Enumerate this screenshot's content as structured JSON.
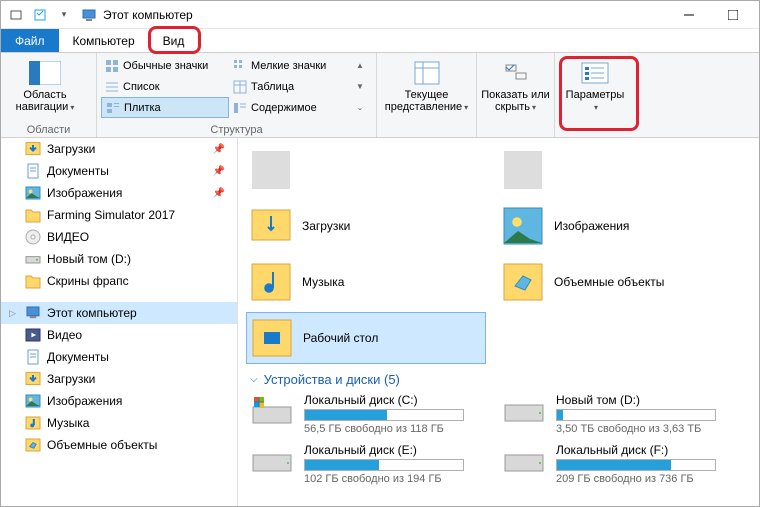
{
  "title": "Этот компьютер",
  "tabs": {
    "file": "Файл",
    "computer": "Компьютер",
    "view": "Вид"
  },
  "ribbon": {
    "nav_area": {
      "label": "Область навигации",
      "group": "Области"
    },
    "layout": {
      "regular": "Обычные значки",
      "small": "Мелкие значки",
      "list": "Список",
      "table": "Таблица",
      "tiles": "Плитка",
      "content": "Содержимое",
      "group": "Структура"
    },
    "view": {
      "current": "Текущее представление"
    },
    "show": {
      "label": "Показать или скрыть"
    },
    "params": {
      "label": "Параметры"
    }
  },
  "sidebar": [
    {
      "label": "Загрузки",
      "icon": "downloads",
      "pin": true
    },
    {
      "label": "Документы",
      "icon": "documents",
      "pin": true
    },
    {
      "label": "Изображения",
      "icon": "pictures",
      "pin": true
    },
    {
      "label": "Farming Simulator 2017",
      "icon": "folder"
    },
    {
      "label": "ВИДЕО",
      "icon": "disc"
    },
    {
      "label": "Новый том (D:)",
      "icon": "drive"
    },
    {
      "label": "Скрины фрапс",
      "icon": "folder"
    },
    {
      "label": "Этот компьютер",
      "icon": "pc",
      "selected": true,
      "chev": true
    },
    {
      "label": "Видео",
      "icon": "video"
    },
    {
      "label": "Документы",
      "icon": "documents"
    },
    {
      "label": "Загрузки",
      "icon": "downloads"
    },
    {
      "label": "Изображения",
      "icon": "pictures"
    },
    {
      "label": "Музыка",
      "icon": "music"
    },
    {
      "label": "Объемные объекты",
      "icon": "3d"
    }
  ],
  "folder_tiles": [
    {
      "label": "",
      "icon": "video-partial"
    },
    {
      "label": "",
      "icon": "folder-partial"
    },
    {
      "label": "Загрузки",
      "icon": "downloads"
    },
    {
      "label": "Изображения",
      "icon": "pictures"
    },
    {
      "label": "Музыка",
      "icon": "music"
    },
    {
      "label": "Объемные объекты",
      "icon": "3d"
    },
    {
      "label": "Рабочий стол",
      "icon": "desktop",
      "selected": true
    }
  ],
  "drives_header": "Устройства и диски (5)",
  "drives": [
    {
      "name": "Локальный диск (C:)",
      "free": "56,5 ГБ свободно из 118 ГБ",
      "pct": 52,
      "os": true
    },
    {
      "name": "Новый том (D:)",
      "free": "3,50 ТБ свободно из 3,63 ТБ",
      "pct": 4
    },
    {
      "name": "Локальный диск (E:)",
      "free": "102 ГБ свободно из 194 ГБ",
      "pct": 47
    },
    {
      "name": "Локальный диск (F:)",
      "free": "209 ГБ свободно из 736 ГБ",
      "pct": 72
    }
  ]
}
